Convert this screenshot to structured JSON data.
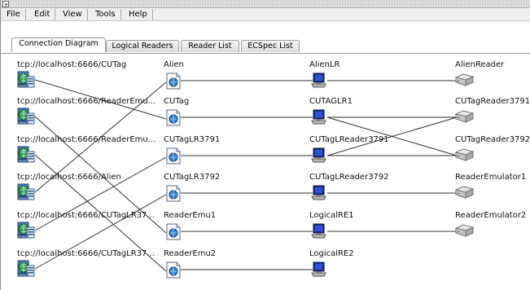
{
  "menu": [
    "File",
    "Edit",
    "View",
    "Tools",
    "Help"
  ],
  "tabs": [
    "Connection Diagram",
    "Logical Readers",
    "Reader List",
    "ECSpec List"
  ],
  "active_tab": "Connection Diagram",
  "columns": {
    "sources": [
      "tcp://localhost:6666/CUTag",
      "tcp://localhost:6666/ReaderEmu...",
      "tcp://localhost:6666/ReaderEmu...",
      "tcp://localhost:6666/Alien",
      "tcp://localhost:6666/CUTagLR37...",
      "tcp://localhost:6666/CUTagLR37..."
    ],
    "specs": [
      "Alien",
      "CUTag",
      "CUTagLR3791",
      "CUTagLR3792",
      "ReaderEmu1",
      "ReaderEmu2"
    ],
    "logical_readers": [
      "AlienLR",
      "CUTAGLR1",
      "CUTagLReader3791",
      "CUTagLReader3792",
      "LogicalRE1",
      "LogicalRE2"
    ],
    "readers": [
      "AlienReader",
      "CUTagReader3791",
      "CUTagReader3792",
      "ReaderEmulator1",
      "ReaderEmulator2"
    ]
  },
  "icons": {
    "source": "network-server-icon",
    "spec": "document-icon",
    "logical_reader": "computer-icon",
    "reader": "rfid-reader-device-icon"
  }
}
